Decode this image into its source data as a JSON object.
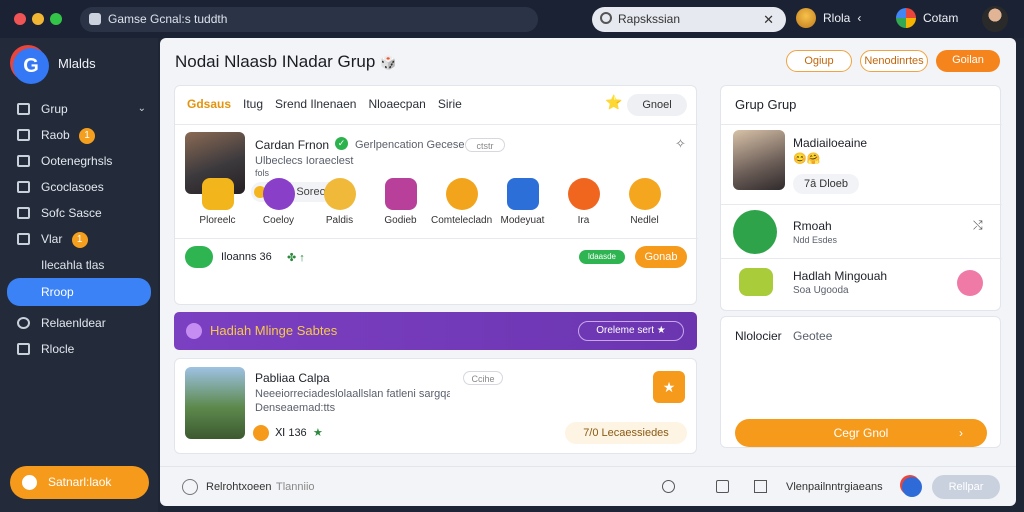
{
  "browser": {
    "tab_title": "Gamse Gcnal:s tuddth",
    "search_text": "Rapskssian",
    "close_glyph": "✕",
    "user1_name": "Rlola",
    "user1_arrow": "‹",
    "user2_name": "Cotam"
  },
  "sidebar": {
    "logo_letter": "G",
    "brand": "Mlalds",
    "items": [
      {
        "label": "Grup",
        "icon": "group-icon",
        "chevron": "⌄"
      },
      {
        "label": "Raob",
        "icon": "doc-icon",
        "badge": "1"
      },
      {
        "label": "Ootenegrhsls",
        "icon": "user-icon"
      },
      {
        "label": "Gcoclasoes",
        "icon": "people-icon"
      },
      {
        "label": "Sofc Sasce",
        "icon": "folder-icon"
      },
      {
        "label": "Vlar",
        "icon": "hand-icon",
        "badge": "1"
      }
    ],
    "sub_label": "Ilecahla tlas",
    "active_item": "Rroop",
    "items2": [
      {
        "label": "Relaenldear",
        "icon": "search-icon"
      },
      {
        "label": "Rlocle",
        "icon": "media-icon"
      }
    ],
    "cta_label": "Satnarl:laok"
  },
  "main": {
    "title": "Nodai Nlaasb INadar Grup",
    "title_emoji": "🎲",
    "header_buttons": [
      "Ogiup",
      "Nenodinrtes",
      "Goilan"
    ],
    "feed": {
      "tabs": [
        "Gdsaus",
        "Itug",
        "Srend Ilnenaen",
        "Nloaecpan",
        "Sirie"
      ],
      "star": "⭐",
      "groot": "Gnoel",
      "post1": {
        "name": "Cardan Frnon",
        "verified": "✓",
        "meta": "Gerlpencation Gecese",
        "tag": "ctstr",
        "line1": "Ulbeclecs Ioraeclest",
        "line2": "fols",
        "chip": "Ilo.ig Soreode",
        "more": "✧"
      },
      "icons": [
        {
          "label": "Ploreelc",
          "icon": "coin-stack-icon",
          "color": "#f2b51b"
        },
        {
          "label": "Coeloy",
          "icon": "basket-icon",
          "color": "#8a3fc9"
        },
        {
          "label": "Paldis",
          "icon": "coins-icon",
          "color": "#f0b93a"
        },
        {
          "label": "Godieb",
          "icon": "box-icon",
          "color": "#b9409a"
        },
        {
          "label": "Comtelecladns",
          "icon": "coins-pin-icon",
          "color": "#f2a51c"
        },
        {
          "label": "Modeyuat",
          "icon": "cube-icon",
          "color": "#2d6fd8"
        },
        {
          "label": "Ira",
          "icon": "swirl-icon",
          "color": "#f0661f"
        },
        {
          "label": "Nedlel",
          "icon": "bird-icon",
          "color": "#f5a61f"
        }
      ],
      "stats_text": "Iloanns 36",
      "stats_extra": "✤ ↑",
      "stats_badge": "ldaasde",
      "stats_button": "Gonab"
    },
    "banner": {
      "title": "Hadiah Mlinge Sabtes",
      "button": "Oreleme sert ★"
    },
    "post2": {
      "name": "Pabliaa Calpa",
      "tag": "Ccihe",
      "line1": "Neeeiorreciadeslolaallslan fatleni sargqaun",
      "line2": "Denseaemad:tts",
      "score": "Ⅺ 136",
      "score_extra": "★",
      "pill": "7/0 Lecaessiedes",
      "star_btn": "★"
    },
    "right": {
      "title": "Grup Grup",
      "item1_name": "Madiailoeaine",
      "item1_emojis": "😊🤗",
      "item1_chip": "7ā Dloeb",
      "item2_name": "Rmoah",
      "item2_sub": "Ndd Esdes",
      "item2_action": "⤭",
      "item3_name": "Hadlah Mingouah",
      "item3_sub": "Soa Ugooda",
      "box_title": "Nlolocier",
      "box_title2": "Geotee",
      "cta": "Cegr Gnol",
      "cta_arrow": "›"
    },
    "footer": {
      "left1": "Relrohtxoeen",
      "left2": "Tlanniio",
      "middle": "Vlenpailnntrgiaeans",
      "button": "Rellpar"
    }
  }
}
